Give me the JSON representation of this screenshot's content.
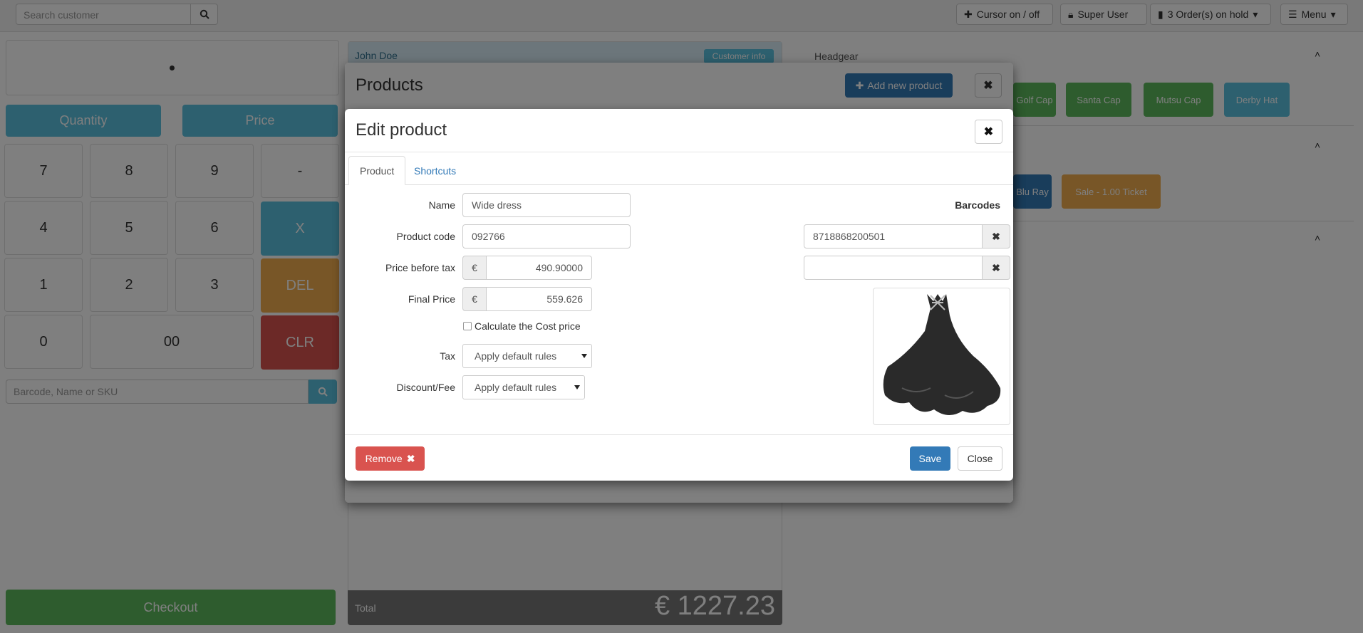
{
  "topbar": {
    "search_placeholder": "Search customer",
    "cursor_toggle": "Cursor on / off",
    "user": "Super User",
    "orders_on_hold": "3 Order(s) on hold",
    "menu": "Menu"
  },
  "keypad": {
    "quantity": "Quantity",
    "price": "Price",
    "keys": [
      "7",
      "8",
      "9",
      "-",
      "4",
      "5",
      "6",
      "X",
      "1",
      "2",
      "3",
      "DEL",
      "0",
      "00",
      "CLR"
    ],
    "barcode_placeholder": "Barcode, Name or SKU",
    "checkout": "Checkout"
  },
  "order": {
    "customer": "John Doe",
    "customer_badge": "Customer info",
    "total_label": "Total",
    "total_value": "€ 1227.23"
  },
  "categories": {
    "headgear": "Headgear",
    "items": [
      "Golf Cap",
      "Santa Cap",
      "Mutsu Cap",
      "Derby Hat",
      "Blu Ray",
      "Sale - 1.00 Ticket"
    ]
  },
  "products_modal": {
    "title": "Products",
    "add_new": "Add new product"
  },
  "edit_modal": {
    "title": "Edit product",
    "tabs": [
      "Product",
      "Shortcuts"
    ],
    "labels": {
      "name": "Name",
      "product_code": "Product code",
      "price_before_tax": "Price before tax",
      "final_price": "Final Price",
      "calculate_cost": "Calculate the Cost price",
      "tax": "Tax",
      "discount_fee": "Discount/Fee"
    },
    "values": {
      "name": "Wide dress",
      "product_code": "092766",
      "currency": "€",
      "price_before_tax": "490.90000",
      "final_price": "559.626",
      "tax": "Apply default rules",
      "discount_fee": "Apply default rules"
    },
    "barcodes_title": "Barcodes",
    "barcodes": [
      "8718868200501",
      ""
    ],
    "remove": "Remove",
    "save": "Save",
    "close": "Close"
  },
  "colors": {
    "primary": "#337ab7",
    "danger": "#d9534f",
    "info": "#5bc0de",
    "success": "#5cb85c",
    "warning": "#f0ad4e"
  }
}
